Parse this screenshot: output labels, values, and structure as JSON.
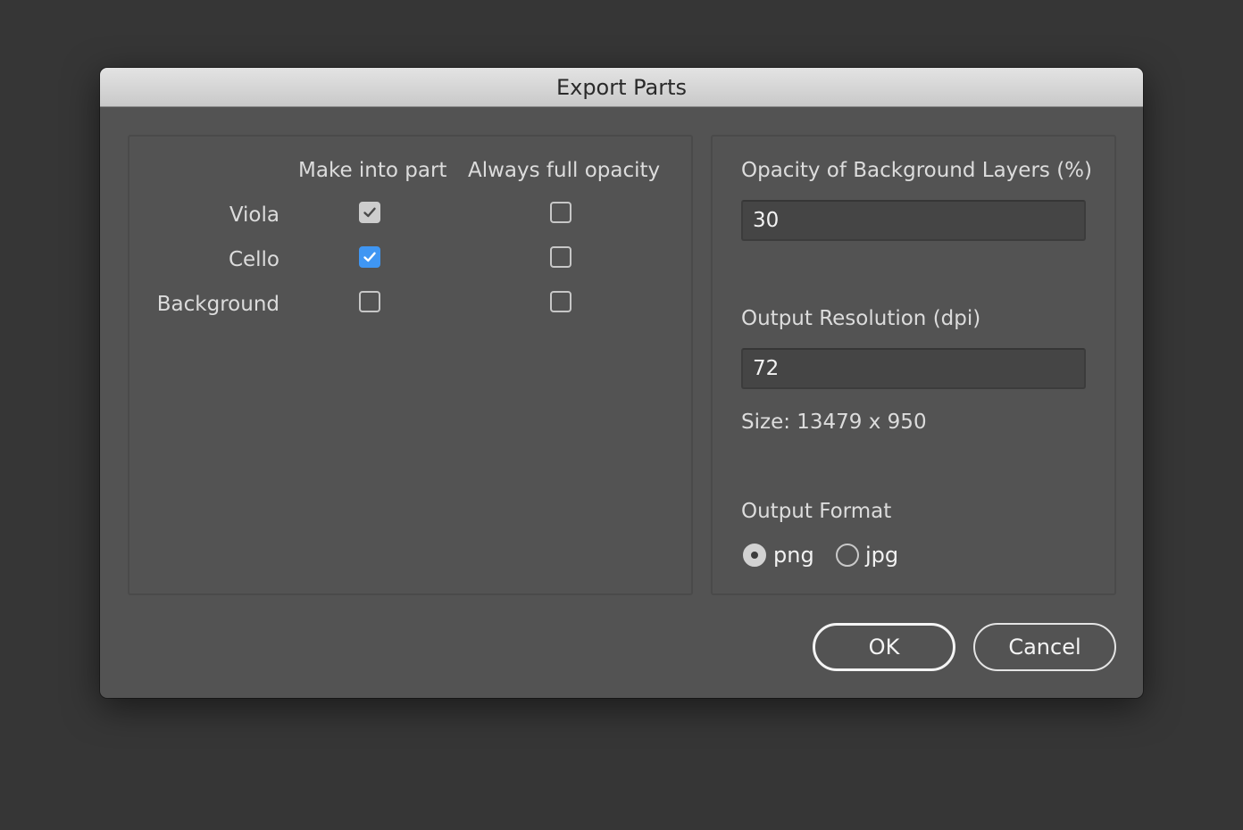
{
  "dialog": {
    "title": "Export Parts"
  },
  "parts": {
    "col_make_into_part": "Make into part",
    "col_full_opacity": "Always full opacity",
    "rows": [
      {
        "name": "Viola",
        "make_into_part": true,
        "full_opacity": false
      },
      {
        "name": "Cello",
        "make_into_part": true,
        "full_opacity": false
      },
      {
        "name": "Background",
        "make_into_part": false,
        "full_opacity": false
      }
    ]
  },
  "settings": {
    "opacity_label": "Opacity of Background Layers (%)",
    "opacity_value": "30",
    "resolution_label": "Output Resolution (dpi)",
    "resolution_value": "72",
    "size_text": "Size: 13479 x 950",
    "format_label": "Output Format",
    "formats": [
      {
        "label": "png",
        "selected": true
      },
      {
        "label": "jpg",
        "selected": false
      }
    ]
  },
  "buttons": {
    "ok_label": "OK",
    "cancel_label": "Cancel"
  },
  "colors": {
    "background": "#363636",
    "dialog": "#535353",
    "accent_check": "#3f96f3"
  }
}
